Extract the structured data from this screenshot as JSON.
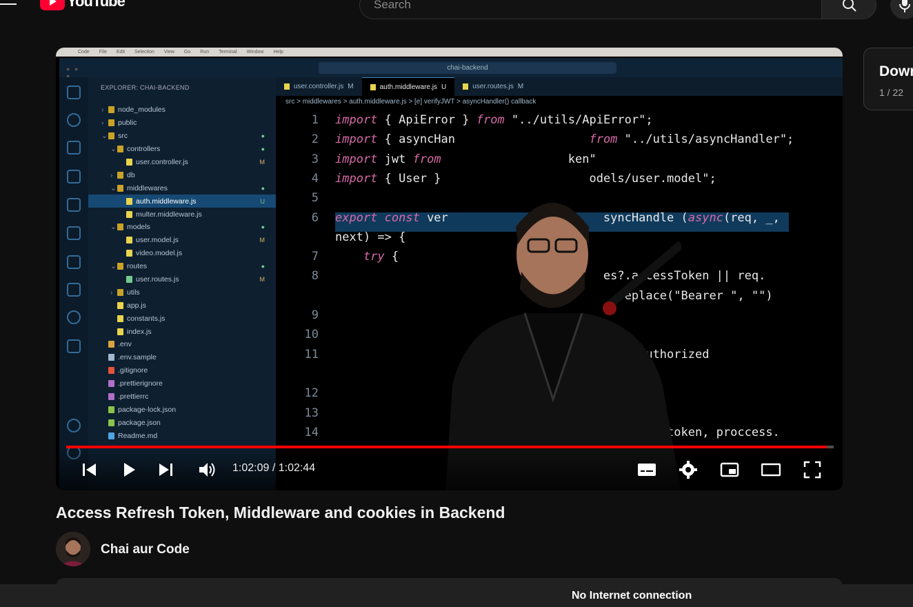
{
  "header": {
    "logo_text": "YouTube",
    "search_placeholder": "Search",
    "icons": [
      "menu-icon",
      "search-icon",
      "mic-icon"
    ]
  },
  "player": {
    "current_time": "1:02:09",
    "duration": "1:02:44",
    "time_display": "1:02:09 / 1:02:44",
    "progress_fraction": 0.991,
    "colors": {
      "progress": "#ff0000"
    }
  },
  "vscode": {
    "mac_menu": [
      "Code",
      "File",
      "Edit",
      "Selection",
      "View",
      "Go",
      "Run",
      "Terminal",
      "Window",
      "Help"
    ],
    "command_center": "chai-backend",
    "explorer_header": "EXPLORER: CHAI-BACKEND",
    "tree": [
      {
        "indent": 1,
        "kind": "folder",
        "label": "node_modules",
        "mark": ""
      },
      {
        "indent": 1,
        "kind": "folder",
        "label": "public",
        "mark": ""
      },
      {
        "indent": 1,
        "kind": "folder-open",
        "label": "src",
        "mark": "●"
      },
      {
        "indent": 2,
        "kind": "folder-open",
        "label": "controllers",
        "mark": "●"
      },
      {
        "indent": 3,
        "kind": "js",
        "label": "user.controller.js",
        "mark": "M"
      },
      {
        "indent": 2,
        "kind": "folder",
        "label": "db",
        "mark": ""
      },
      {
        "indent": 2,
        "kind": "folder-open",
        "label": "middlewares",
        "mark": "●"
      },
      {
        "indent": 3,
        "kind": "js",
        "label": "auth.middleware.js",
        "mark": "U",
        "selected": true
      },
      {
        "indent": 3,
        "kind": "js",
        "label": "multer.middleware.js",
        "mark": ""
      },
      {
        "indent": 2,
        "kind": "folder-open",
        "label": "models",
        "mark": "●"
      },
      {
        "indent": 3,
        "kind": "js",
        "label": "user.model.js",
        "mark": "M"
      },
      {
        "indent": 3,
        "kind": "js",
        "label": "video.model.js",
        "mark": ""
      },
      {
        "indent": 2,
        "kind": "folder-open",
        "label": "routes",
        "mark": "●"
      },
      {
        "indent": 3,
        "kind": "route",
        "label": "user.routes.js",
        "mark": "M"
      },
      {
        "indent": 2,
        "kind": "folder",
        "label": "utils",
        "mark": ""
      },
      {
        "indent": 2,
        "kind": "js",
        "label": "app.js",
        "mark": ""
      },
      {
        "indent": 2,
        "kind": "js",
        "label": "constants.js",
        "mark": ""
      },
      {
        "indent": 2,
        "kind": "js",
        "label": "index.js",
        "mark": ""
      },
      {
        "indent": 1,
        "kind": "env",
        "label": ".env",
        "mark": ""
      },
      {
        "indent": 1,
        "kind": "file",
        "label": ".env.sample",
        "mark": ""
      },
      {
        "indent": 1,
        "kind": "git",
        "label": ".gitignore",
        "mark": ""
      },
      {
        "indent": 1,
        "kind": "prettier",
        "label": ".prettierignore",
        "mark": ""
      },
      {
        "indent": 1,
        "kind": "prettier",
        "label": ".prettierrc",
        "mark": ""
      },
      {
        "indent": 1,
        "kind": "json",
        "label": "package-lock.json",
        "mark": ""
      },
      {
        "indent": 1,
        "kind": "json",
        "label": "package.json",
        "mark": ""
      },
      {
        "indent": 1,
        "kind": "info",
        "label": "Readme.md",
        "mark": ""
      }
    ],
    "tabs": [
      {
        "label": "user.controller.js",
        "mark": "M",
        "active": false
      },
      {
        "label": "auth.middleware.js",
        "mark": "U",
        "active": true
      },
      {
        "label": "user.routes.js",
        "mark": "M",
        "active": false
      }
    ],
    "breadcrumb": "src > middlewares > auth.middleware.js > [e] verifyJWT > asyncHandler() callback",
    "code_lines": [
      {
        "n": "1",
        "html": "<span class='kw'>import</span> { ApiError } <span class='kw'>from</span> \"../utils/ApiError\";"
      },
      {
        "n": "2",
        "html": "<span class='kw'>import</span> { asyncHan                   <span class='kw'>from</span> \"../utils/asyncHandler\";"
      },
      {
        "n": "3",
        "html": "<span class='kw'>import</span> jwt <span class='kw'>from</span>                  ken\""
      },
      {
        "n": "4",
        "html": "<span class='kw'>import</span> { User }                     odels/user.model\";"
      },
      {
        "n": "5",
        "html": ""
      },
      {
        "n": "6",
        "html": "<span class='kw'>export const</span> ver                      syncHandle (<span class='kw'>async</span>(req, _,"
      },
      {
        "n": "",
        "html": "next) =&gt; {"
      },
      {
        "n": "7",
        "html": "    <span class='kw'>try</span> {"
      },
      {
        "n": "8",
        "html": "                                      es?.accessToken || req."
      },
      {
        "n": "",
        "html": "                                        replace(\"Bearer \", \"\")"
      },
      {
        "n": "9",
        "html": ""
      },
      {
        "n": "10",
        "html": ""
      },
      {
        "n": "11",
        "html": "                                        \"Unauthorized"
      },
      {
        "n": "",
        "html": ""
      },
      {
        "n": "12",
        "html": ""
      },
      {
        "n": "13",
        "html": ""
      },
      {
        "n": "14",
        "html": "                                        verify(token, proccess."
      }
    ]
  },
  "video": {
    "title": "Access Refresh Token, Middleware and cookies in Backend",
    "channel": "Chai aur Code"
  },
  "playlist": {
    "title": "Down",
    "counter": "1 / 22"
  },
  "status": {
    "offline_message": "No Internet connection"
  }
}
